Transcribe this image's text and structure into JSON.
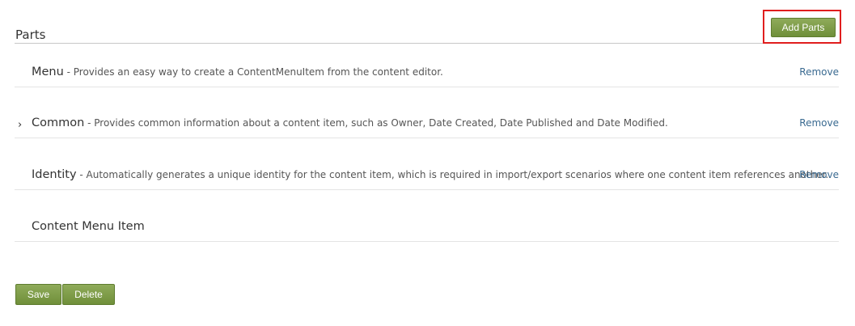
{
  "section": {
    "title": "Parts",
    "add_button_label": "Add Parts"
  },
  "parts": [
    {
      "name": "Menu",
      "description": " - Provides an easy way to create a ContentMenuItem from the content editor.",
      "remove_label": "Remove",
      "expander": ""
    },
    {
      "name": "Common",
      "description": " - Provides common information about a content item, such as Owner, Date Created, Date Published and Date Modified.",
      "remove_label": "Remove",
      "expander": "›"
    },
    {
      "name": "Identity",
      "description": " - Automatically generates a unique identity for the content item, which is required in import/export scenarios where one content item references another.",
      "remove_label": "Remove",
      "expander": ""
    },
    {
      "name": "Content Menu Item",
      "description": "",
      "remove_label": "",
      "expander": ""
    }
  ],
  "footer": {
    "save_label": "Save",
    "delete_label": "Delete"
  },
  "colors": {
    "button_green": "#7a9a45",
    "highlight_red": "#e01e1e",
    "link_blue": "#3a6a91"
  }
}
